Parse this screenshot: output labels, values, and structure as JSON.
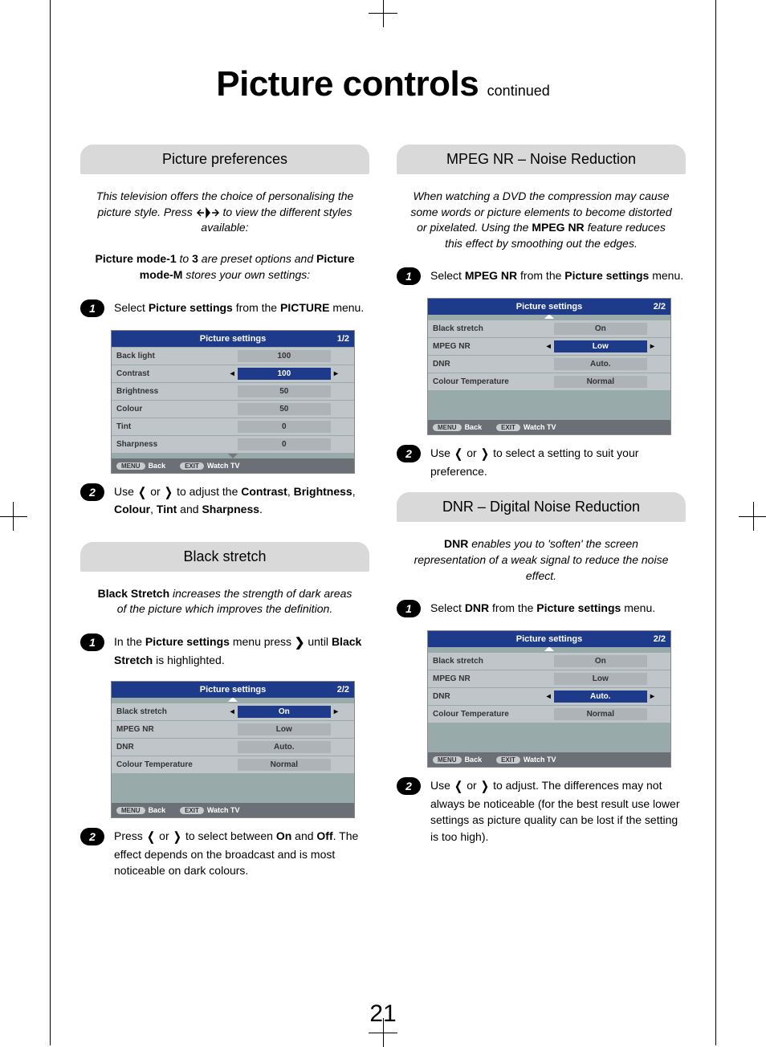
{
  "page_title_big": "Picture controls",
  "page_title_small": "continued",
  "page_number": "21",
  "left": {
    "sec1_header": "Picture preferences",
    "sec1_intro_line1": "This television offers the choice of personalising the picture style. Press ",
    "sec1_intro_line2": " to view the different styles available:",
    "sec1_modes_line": "Picture mode-1 to 3 are preset options and Picture mode-M stores your own settings:",
    "sec1_step1": "Select Picture settings from the PICTURE menu.",
    "sec1_step2": "Use ❬ or ❭ to adjust the Contrast, Brightness, Colour, Tint and Sharpness.",
    "osd1": {
      "title": "Picture settings",
      "page": "1/2",
      "rows": [
        {
          "label": "Back light",
          "value": "100",
          "sel": false
        },
        {
          "label": "Contrast",
          "value": "100",
          "sel": true
        },
        {
          "label": "Brightness",
          "value": "50",
          "sel": false
        },
        {
          "label": "Colour",
          "value": "50",
          "sel": false
        },
        {
          "label": "Tint",
          "value": "0",
          "sel": false
        },
        {
          "label": "Sharpness",
          "value": "0",
          "sel": false
        }
      ],
      "menu_pill": "MENU",
      "menu_label": "Back",
      "exit_pill": "EXIT",
      "exit_label": "Watch TV"
    },
    "sec2_header": "Black stretch",
    "sec2_intro": "Black Stretch increases the strength of dark areas of the picture which improves the definition.",
    "sec2_step1": "In the Picture settings menu press ❯ until Black Stretch is highlighted.",
    "sec2_step2": "Press ❬ or ❭ to select between On and Off. The effect depends on the broadcast and is most noticeable on dark colours.",
    "osd2": {
      "title": "Picture settings",
      "page": "2/2",
      "rows": [
        {
          "label": "Black stretch",
          "value": "On",
          "sel": true
        },
        {
          "label": "MPEG NR",
          "value": "Low",
          "sel": false
        },
        {
          "label": "DNR",
          "value": "Auto.",
          "sel": false
        },
        {
          "label": "Colour Temperature",
          "value": "Normal",
          "sel": false
        }
      ],
      "menu_pill": "MENU",
      "menu_label": "Back",
      "exit_pill": "EXIT",
      "exit_label": "Watch TV"
    }
  },
  "right": {
    "sec1_header": "MPEG NR – Noise Reduction",
    "sec1_intro": "When watching a DVD the compression may cause some words or picture elements to become distorted or pixelated. Using the MPEG NR feature reduces this effect by smoothing out the edges.",
    "sec1_step1": "Select MPEG NR from the Picture settings menu.",
    "sec1_step2": "Use ❬ or ❭ to select a setting to suit your preference.",
    "osd1": {
      "title": "Picture settings",
      "page": "2/2",
      "rows": [
        {
          "label": "Black stretch",
          "value": "On",
          "sel": false
        },
        {
          "label": "MPEG NR",
          "value": "Low",
          "sel": true
        },
        {
          "label": "DNR",
          "value": "Auto.",
          "sel": false
        },
        {
          "label": "Colour Temperature",
          "value": "Normal",
          "sel": false
        }
      ],
      "menu_pill": "MENU",
      "menu_label": "Back",
      "exit_pill": "EXIT",
      "exit_label": "Watch TV"
    },
    "sec2_header": "DNR – Digital Noise Reduction",
    "sec2_intro": "DNR enables you to 'soften' the screen representation of a weak signal to reduce the noise effect.",
    "sec2_step1": "Select DNR from the Picture settings menu.",
    "sec2_step2": "Use ❬ or ❭ to adjust. The differences may not always be noticeable (for the best result use lower settings as picture quality can be lost if the setting is too high).",
    "osd2": {
      "title": "Picture settings",
      "page": "2/2",
      "rows": [
        {
          "label": "Black stretch",
          "value": "On",
          "sel": false
        },
        {
          "label": "MPEG NR",
          "value": "Low",
          "sel": false
        },
        {
          "label": "DNR",
          "value": "Auto.",
          "sel": true
        },
        {
          "label": "Colour Temperature",
          "value": "Normal",
          "sel": false
        }
      ],
      "menu_pill": "MENU",
      "menu_label": "Back",
      "exit_pill": "EXIT",
      "exit_label": "Watch TV"
    }
  }
}
